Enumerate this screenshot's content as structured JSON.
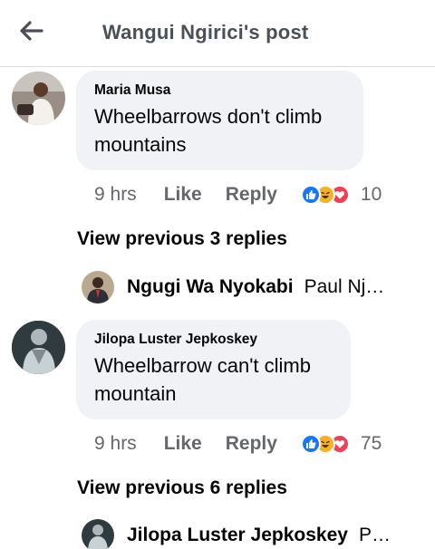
{
  "header": {
    "title": "Wangui Ngirici's post"
  },
  "comments": [
    {
      "author": "Maria Musa",
      "text": "Wheelbarrows don't climb\nmountains",
      "time": "9 hrs",
      "like_label": "Like",
      "reply_label": "Reply",
      "reaction_count": "10",
      "view_previous": "View previous 3 replies",
      "reply_preview": {
        "author": "Ngugi Wa Nyokabi",
        "snippet": "Paul Nj…"
      }
    },
    {
      "author": "Jilopa Luster Jepkoskey",
      "text": "Wheelbarrow can't climb\nmountain",
      "time": "9 hrs",
      "like_label": "Like",
      "reply_label": "Reply",
      "reaction_count": "75",
      "view_previous": "View previous 6 replies",
      "reply_preview": {
        "author": "Jilopa Luster Jepkoskey",
        "snippet": "P…"
      }
    }
  ],
  "colors": {
    "like_blue": "#1877f2",
    "haha_yellow": "#f7b125",
    "love_red": "#f33e58",
    "bubble_bg": "#f0f2f5",
    "meta_gray": "#65676b"
  },
  "icons": [
    "back-arrow-icon",
    "like-reaction-icon",
    "haha-reaction-icon",
    "love-reaction-icon"
  ]
}
